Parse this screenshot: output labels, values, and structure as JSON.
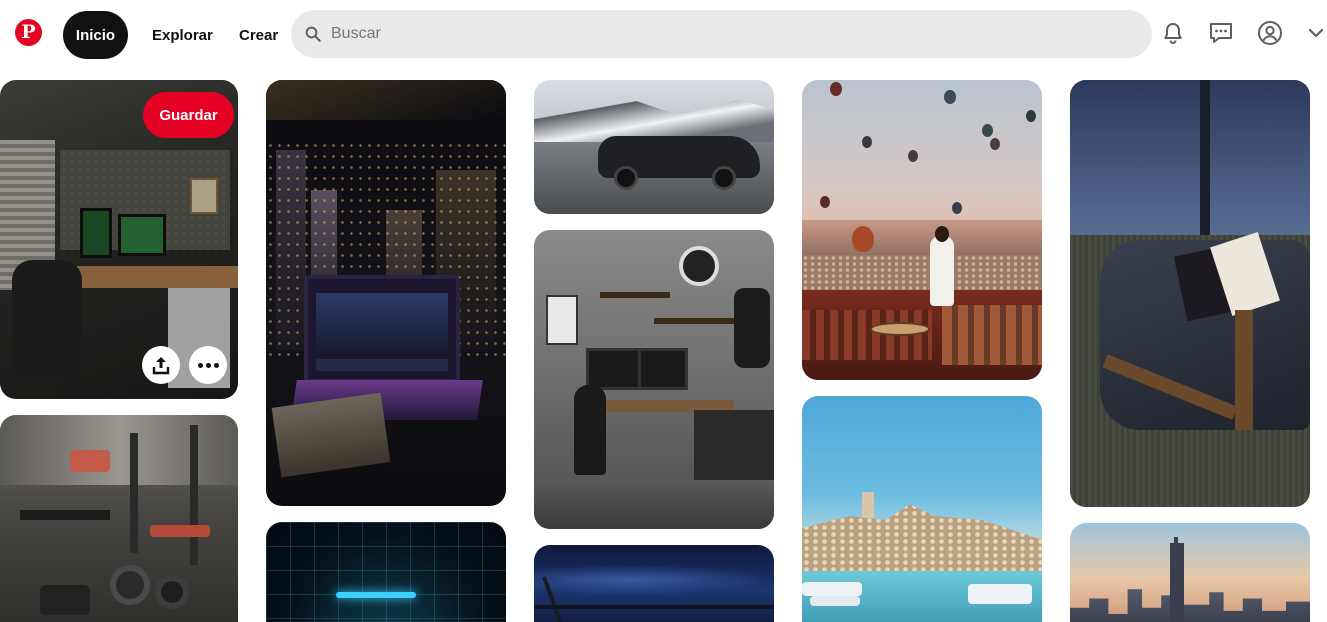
{
  "header": {
    "logo_icon": "pinterest-logo-icon",
    "nav": {
      "home_label": "Inicio",
      "explore_label": "Explorar",
      "create_label": "Crear"
    },
    "search": {
      "placeholder": "Buscar",
      "icon": "search-icon"
    },
    "icons": [
      "bell-icon",
      "message-icon",
      "user-icon",
      "chevron-down-icon"
    ]
  },
  "grid": {
    "hovered_pin": {
      "save_label": "Guardar",
      "actions": [
        "share-icon",
        "more-icon"
      ]
    },
    "pins": [
      {
        "subject": "desk-setup-plants"
      },
      {
        "subject": "gym-weights"
      },
      {
        "subject": "laptop-city-night"
      },
      {
        "subject": "digital-grid"
      },
      {
        "subject": "sports-car-mountains"
      },
      {
        "subject": "desk-setup-gray"
      },
      {
        "subject": "night-bridge"
      },
      {
        "subject": "hot-air-balloons"
      },
      {
        "subject": "coastal-town"
      },
      {
        "subject": "travel-bag-passport"
      },
      {
        "subject": "city-skyline"
      }
    ]
  },
  "colors": {
    "brand": "#e60023",
    "active_nav": "#111111",
    "search_bg": "#e9e9e9"
  }
}
